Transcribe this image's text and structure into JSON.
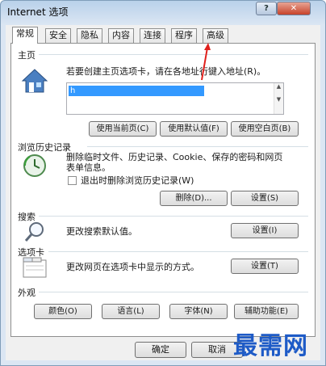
{
  "window": {
    "title": "Internet 选项",
    "help_label": "?",
    "close_label": "✕"
  },
  "tabs": [
    {
      "label": "常规",
      "active": true
    },
    {
      "label": "安全"
    },
    {
      "label": "隐私"
    },
    {
      "label": "内容"
    },
    {
      "label": "连接"
    },
    {
      "label": "程序"
    },
    {
      "label": "高级"
    }
  ],
  "home": {
    "title": "主页",
    "description": "若要创建主页选项卡，请在各地址行键入地址(R)。",
    "url_value": "h",
    "buttons": {
      "use_current": "使用当前页(C)",
      "use_default": "使用默认值(F)",
      "use_blank": "使用空白页(B)"
    }
  },
  "history": {
    "title": "浏览历史记录",
    "description_line1": "删除临时文件、历史记录、Cookie、保存的密码和网页",
    "description_line2": "表单信息。",
    "checkbox_label": "退出时删除浏览历史记录(W)",
    "buttons": {
      "delete": "删除(D)...",
      "settings": "设置(S)"
    }
  },
  "search": {
    "title": "搜索",
    "description": "更改搜索默认值。",
    "settings_button": "设置(I)"
  },
  "tabsgroup": {
    "title": "选项卡",
    "description": "更改网页在选项卡中显示的方式。",
    "settings_button": "设置(T)"
  },
  "appearance": {
    "title": "外观",
    "buttons": {
      "colors": "颜色(O)",
      "languages": "语言(L)",
      "fonts": "字体(N)",
      "accessibility": "辅助功能(E)"
    }
  },
  "footer": {
    "ok": "确定",
    "cancel": "取消"
  },
  "watermark": "最需网",
  "colors": {
    "selection": "#3399ff",
    "arrow": "#e0201c",
    "watermark": "#1e5bc7"
  }
}
